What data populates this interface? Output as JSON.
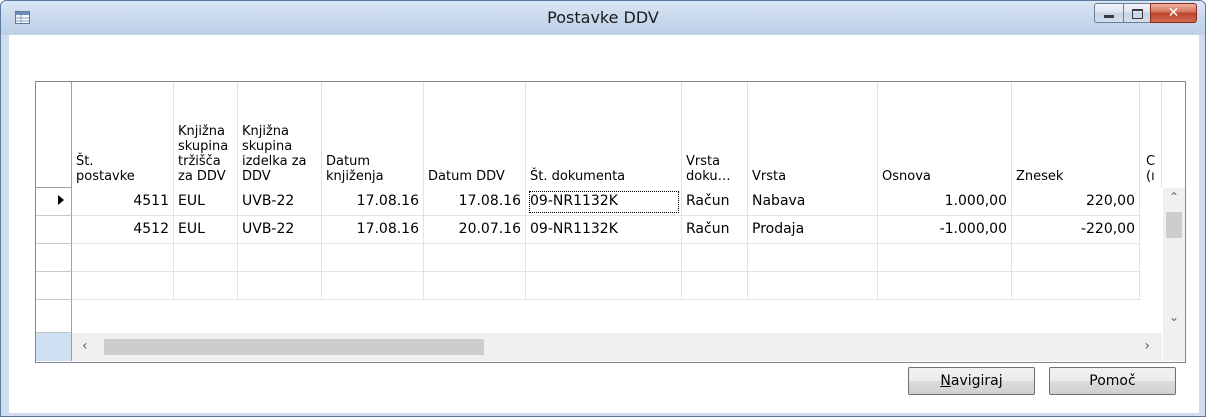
{
  "window": {
    "title": "Postavke DDV",
    "close_glyph": "✕"
  },
  "table": {
    "headers": [
      "Št.\npostavke",
      "Knjižna\nskupina\ntržišča\nza DDV",
      "Knjižna\nskupina\nizdelka za\nDDV",
      "Datum\nknjiženja",
      "Datum DDV",
      "Št. dokumenta",
      "Vrsta\ndoku…",
      "Vrsta",
      "Osnova",
      "Znesek",
      "C\n(ı"
    ],
    "rows": [
      [
        "4511",
        "EUL",
        "UVB-22",
        "17.08.16",
        "17.08.16",
        "09-NR1132K",
        "Račun",
        "Nabava",
        "1.000,00",
        "220,00"
      ],
      [
        "4512",
        "EUL",
        "UVB-22",
        "17.08.16",
        "20.07.16",
        "09-NR1132K",
        "Račun",
        "Prodaja",
        "-1.000,00",
        "-220,00"
      ]
    ]
  },
  "buttons": {
    "navigate_first": "N",
    "navigate_rest": "avigiraj",
    "help": "Pomoč"
  }
}
